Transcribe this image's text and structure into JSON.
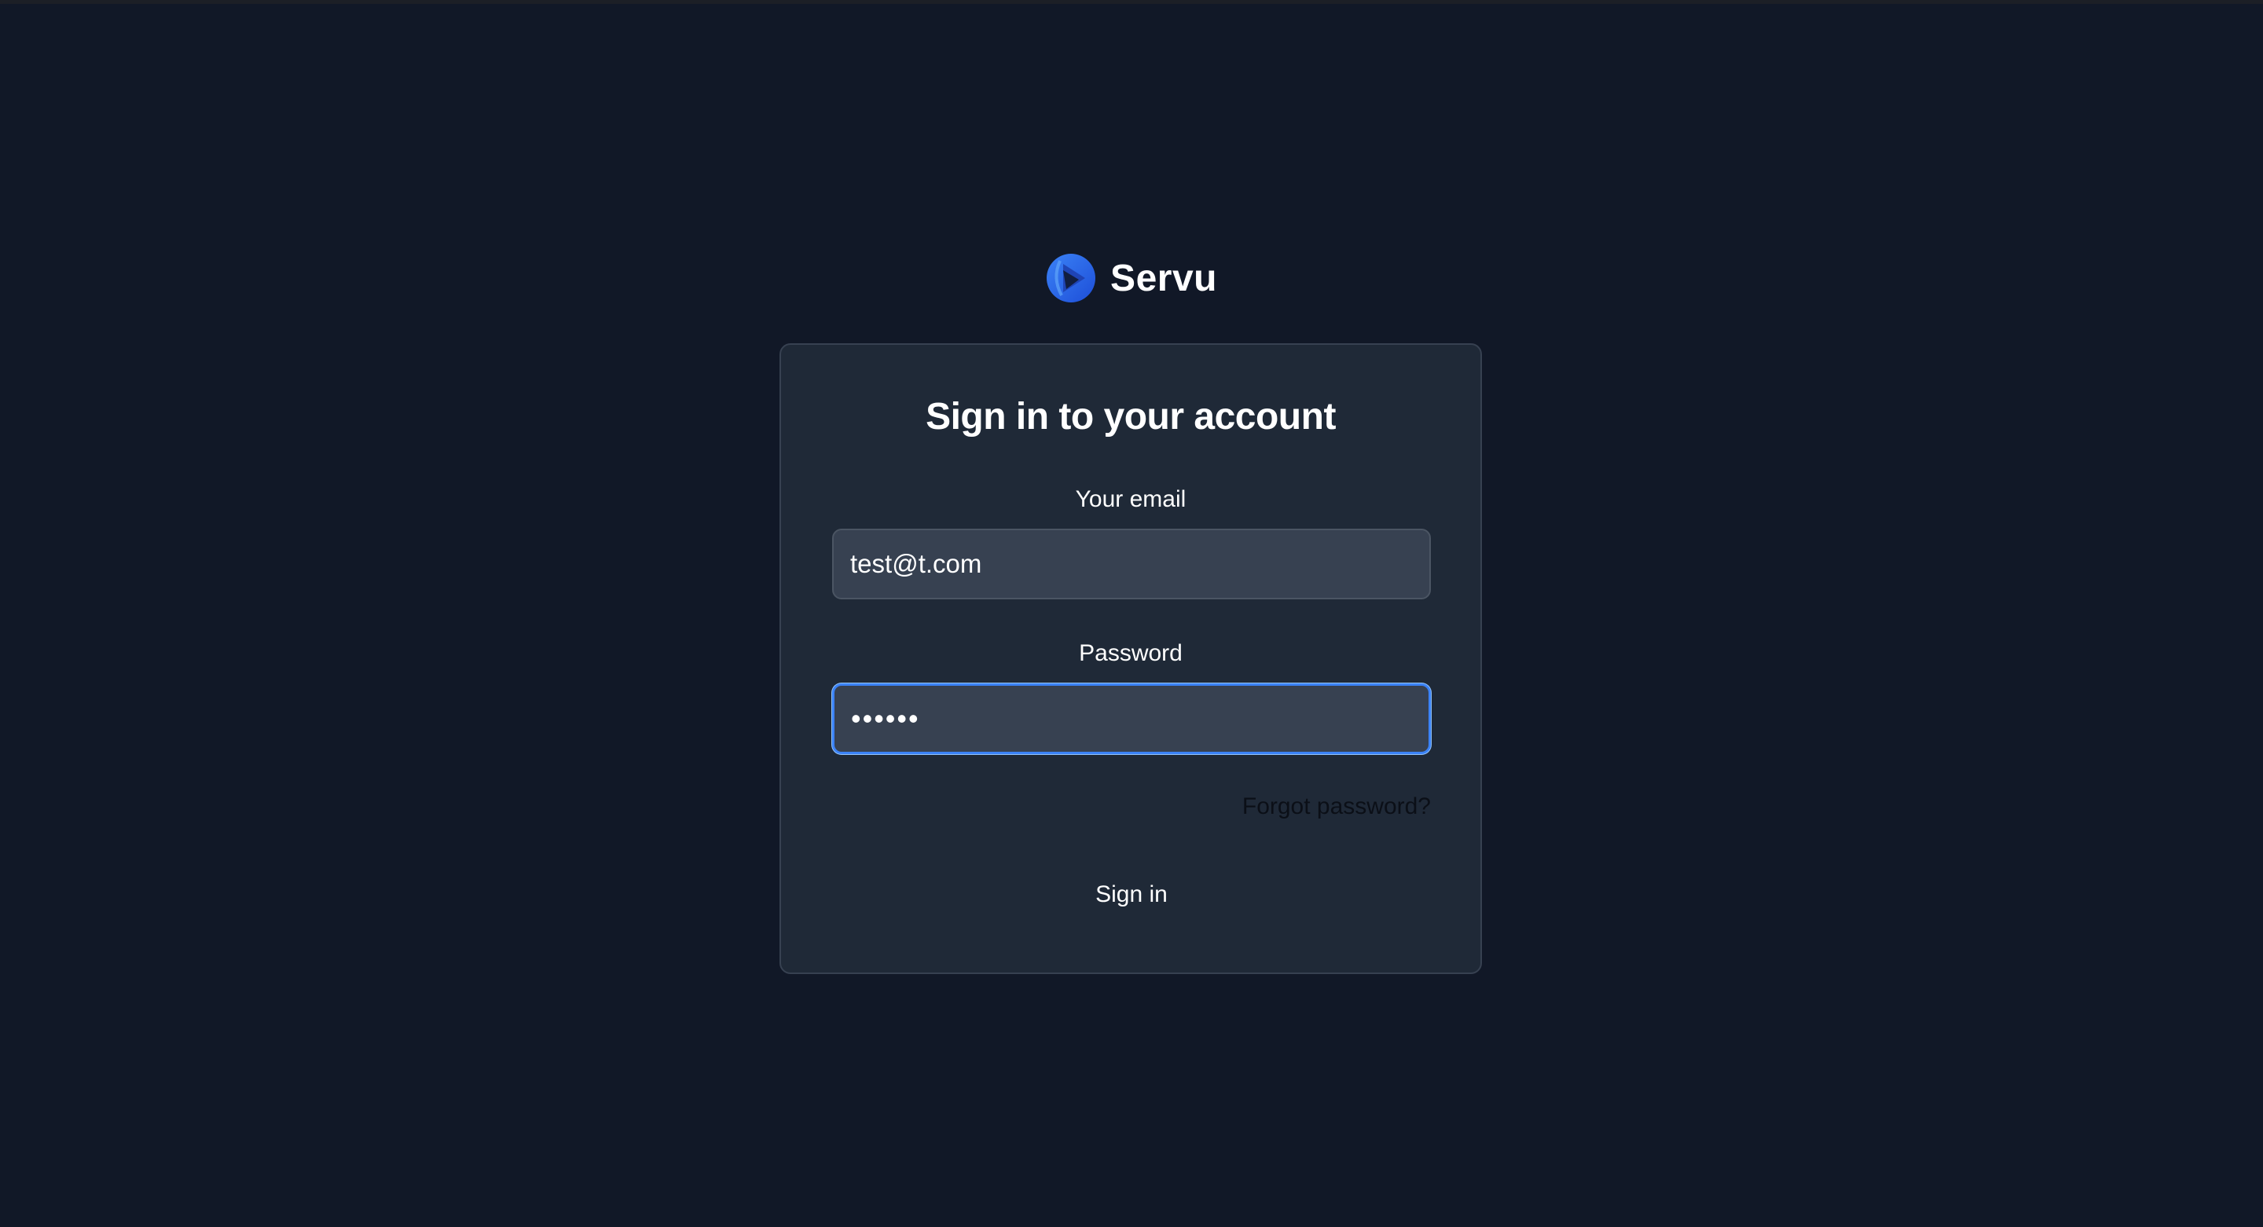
{
  "brand": {
    "name": "Servu",
    "logo_icon": "servu-logo-icon"
  },
  "login": {
    "title": "Sign in to your account",
    "email_label": "Your email",
    "email_value": "test@t.com",
    "password_label": "Password",
    "password_value": "••••••",
    "forgot_password": "Forgot password?",
    "submit_label": "Sign in"
  },
  "colors": {
    "background": "#111827",
    "card": "#1f2937",
    "input": "#374151",
    "focus_ring": "#3b82f6",
    "logo": "#2563eb"
  }
}
